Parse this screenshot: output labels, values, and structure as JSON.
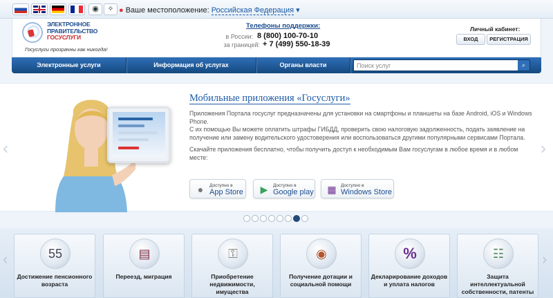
{
  "topbar": {
    "flags": [
      "ru",
      "gb",
      "de",
      "fr"
    ],
    "tool_icons": [
      "eye-icon",
      "compass-icon"
    ],
    "location_label": "Ваше местоположение:",
    "location_value": "Российская Федерация"
  },
  "header": {
    "logo_line1": "ЭЛЕКТРОННОЕ",
    "logo_line2": "ПРАВИТЕЛЬСТВО",
    "logo_line3": "ГОСУСЛУГИ",
    "slogan": "Госуслуги прозрачны как никогда!",
    "phones_title": "Телефоны поддержки:",
    "russia_label": "в России:",
    "russia_phone": "8 (800) 100-70-10",
    "abroad_label": "за границей:",
    "abroad_phone": "+ 7 (499) 550-18-39",
    "cabinet_title": "Личный кабинет:",
    "login": "ВХОД",
    "register": "РЕГИСТРАЦИЯ"
  },
  "nav": {
    "items": [
      "Электронные услуги",
      "Информация об услугах",
      "Органы власти"
    ],
    "search_placeholder": "Поиск услуг"
  },
  "banner": {
    "title": "Мобильные приложения «Госуслуги»",
    "para1": "Приложения Портала госуслуг предназначены для установки на смартфоны и планшеты на базе Android, iOS и Windows Phone.",
    "para2": "С их помощью Вы можете оплатить штрафы ГИБДД, проверить свою налоговую задолженность, подать заявление на получение или замену водительского удостоверения или воспользоваться другими популярными сервисами Портала.",
    "para3": "Скачайте приложения бесплатно, чтобы получить доступ к необходимым Вам госуслугам в любое время и в любом месте:",
    "stores": [
      {
        "small": "Доступно в",
        "big": "App Store",
        "icon": "apple-icon"
      },
      {
        "small": "Доступно в",
        "big": "Google play",
        "icon": "google-play-icon"
      },
      {
        "small": "Доступно в",
        "big": "Windows Store",
        "icon": "windows-icon"
      }
    ],
    "pager_count": 8,
    "pager_active": 7
  },
  "tiles": [
    {
      "label": "Достижение пенсионного возраста",
      "icon": "calendar-55-icon",
      "glyph": "55"
    },
    {
      "label": "Переезд, миграция",
      "icon": "passport-icon",
      "glyph": "▤"
    },
    {
      "label": "Приобретение недвижимости, имущества",
      "icon": "keys-icon",
      "glyph": "⚿"
    },
    {
      "label": "Получение дотации и социальной помощи",
      "icon": "wallet-icon",
      "glyph": "◉"
    },
    {
      "label": "Декларирование доходов и уплата налогов",
      "icon": "percent-icon",
      "glyph": "%"
    },
    {
      "label": "Защита интеллектуальной собственности, патенты",
      "icon": "certificate-icon",
      "glyph": "☷"
    }
  ]
}
